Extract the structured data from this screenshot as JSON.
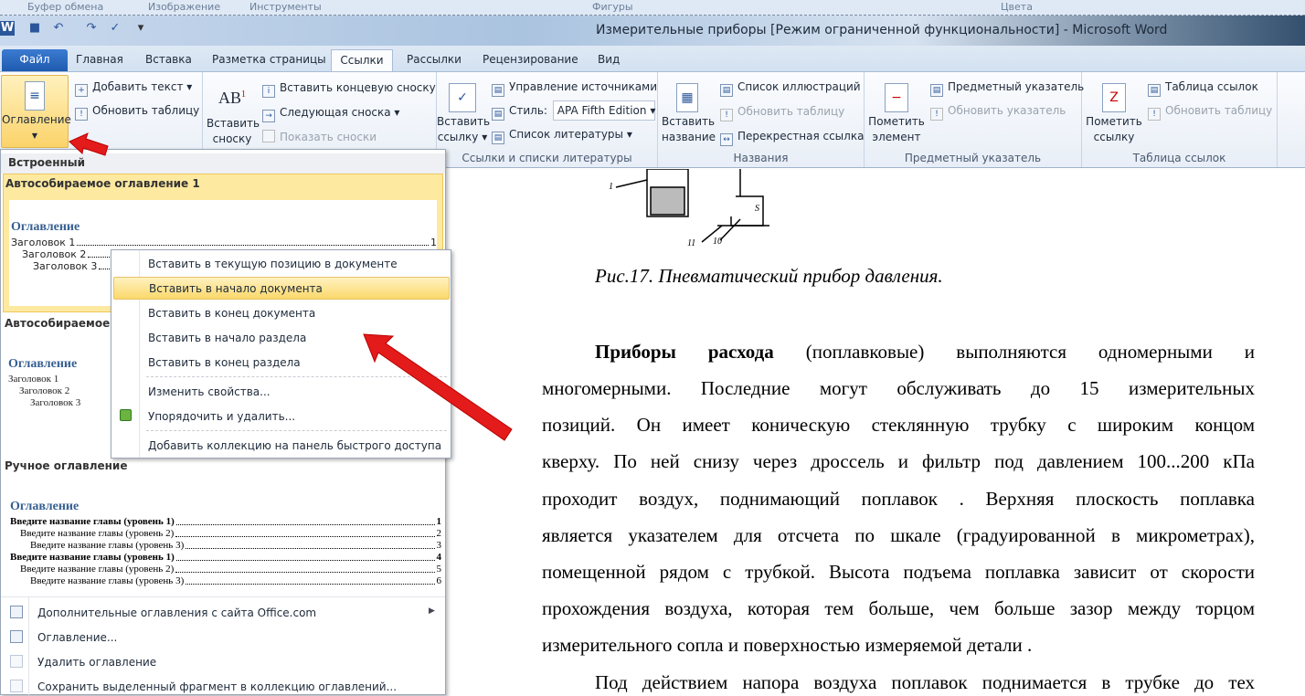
{
  "prev_ribbon_groups": [
    "Буфер обмена",
    "Изображение",
    "Инструменты",
    "Фигуры",
    "Цвета"
  ],
  "window": {
    "title": "Измерительные приборы [Режим ограниченной функциональности]  -  Microsoft Word"
  },
  "tabs": [
    "Файл",
    "Главная",
    "Вставка",
    "Разметка страницы",
    "Ссылки",
    "Рассылки",
    "Рецензирование",
    "Вид"
  ],
  "active_tab": "Ссылки",
  "ribbon": {
    "toc_group": {
      "big": "Оглавление",
      "add_text": "Добавить текст",
      "update_table": "Обновить таблицу"
    },
    "footnotes": {
      "big1": "Вставить",
      "big2": "сноску",
      "insert_endnote": "Вставить концевую сноску",
      "next_footnote": "Следующая сноска",
      "show_notes": "Показать сноски"
    },
    "citations": {
      "big1": "Вставить",
      "big2": "ссылку",
      "manage_sources": "Управление источниками",
      "style_label": "Стиль:",
      "style_value": "APA Fifth Edition",
      "bibliography": "Список литературы",
      "label": "Ссылки и списки литературы"
    },
    "captions": {
      "big1": "Вставить",
      "big2": "название",
      "table_of_figures": "Список иллюстраций",
      "update_table": "Обновить таблицу",
      "cross_ref": "Перекрестная ссылка",
      "label": "Названия"
    },
    "index": {
      "big1": "Пометить",
      "big2": "элемент",
      "insert_index": "Предметный указатель",
      "update_index": "Обновить указатель",
      "label": "Предметный указатель"
    },
    "toa": {
      "big1": "Пометить",
      "big2": "ссылку",
      "insert_toa": "Таблица ссылок",
      "update_table": "Обновить таблицу",
      "label": "Таблица ссылок"
    }
  },
  "toc_menu": {
    "section": "Встроенный",
    "auto1": {
      "title": "Автособираемое оглавление 1",
      "heading": "Оглавление",
      "lines": [
        [
          "Заголовок 1",
          "1"
        ],
        [
          "Заголовок 2",
          ""
        ],
        [
          "Заголовок 3",
          ""
        ]
      ]
    },
    "auto2": {
      "title": "Автособираемое с",
      "heading": "Оглавление",
      "lines": [
        "Заголовок 1",
        "Заголовок 2",
        "Заголовок 3"
      ]
    },
    "manual": {
      "title": "Ручное оглавление",
      "heading": "Оглавление",
      "lines": [
        [
          "Введите название главы (уровень 1)",
          "1"
        ],
        [
          "Введите название главы (уровень 2)",
          "2"
        ],
        [
          "Введите название главы (уровень 3)",
          "3"
        ],
        [
          "Введите название главы (уровень 1)",
          "4"
        ],
        [
          "Введите название главы (уровень 2)",
          "5"
        ],
        [
          "Введите название главы (уровень 3)",
          "6"
        ]
      ]
    },
    "bottom": [
      "Дополнительные оглавления с сайта Office.com",
      "Оглавление...",
      "Удалить оглавление",
      "Сохранить выделенный фрагмент в коллекцию оглавлений..."
    ]
  },
  "context_menu": [
    "Вставить в текущую позицию в документе",
    "Вставить в начало документа",
    "Вставить в конец документа",
    "Вставить в начало раздела",
    "Вставить в конец раздела",
    "Изменить свойства...",
    "Упорядочить и удалить...",
    "Добавить коллекцию на панель быстрого доступа"
  ],
  "document": {
    "figure_labels": [
      "1",
      "11",
      "10",
      "S"
    ],
    "caption": "Рис.17. Пневматический прибор давления.",
    "bold_start": "Приборы расхода",
    "lines": [
      " (поплавковые) выполняются одномерными и",
      "многомерными. Последние могут обслуживать до 15 измерительных",
      "позиций. Он имеет коническую стеклянную трубку с широким концом",
      "кверху. По ней снизу через дроссель и фильтр под давлением 100...200 кПа",
      "проходит воздух, поднимающий поплавок . Верхняя плоскость поплавка",
      "является указателем для отсчета по шкале (градуированной в микрометрах),",
      "помещенной рядом с трубкой. Высота подъема поплавка зависит от скорости",
      "прохождения воздуха, которая тем больше, чем больше зазор между торцом",
      "измерительного сопла и поверхностью измеряемой детали .",
      "Под действием напора воздуха поплавок поднимается в трубке до тех"
    ]
  },
  "colors": {
    "highlight": "#fbd86b",
    "arrow": "#e31b1b",
    "file_tab": "#2a66be",
    "toc_heading": "#365f91"
  }
}
